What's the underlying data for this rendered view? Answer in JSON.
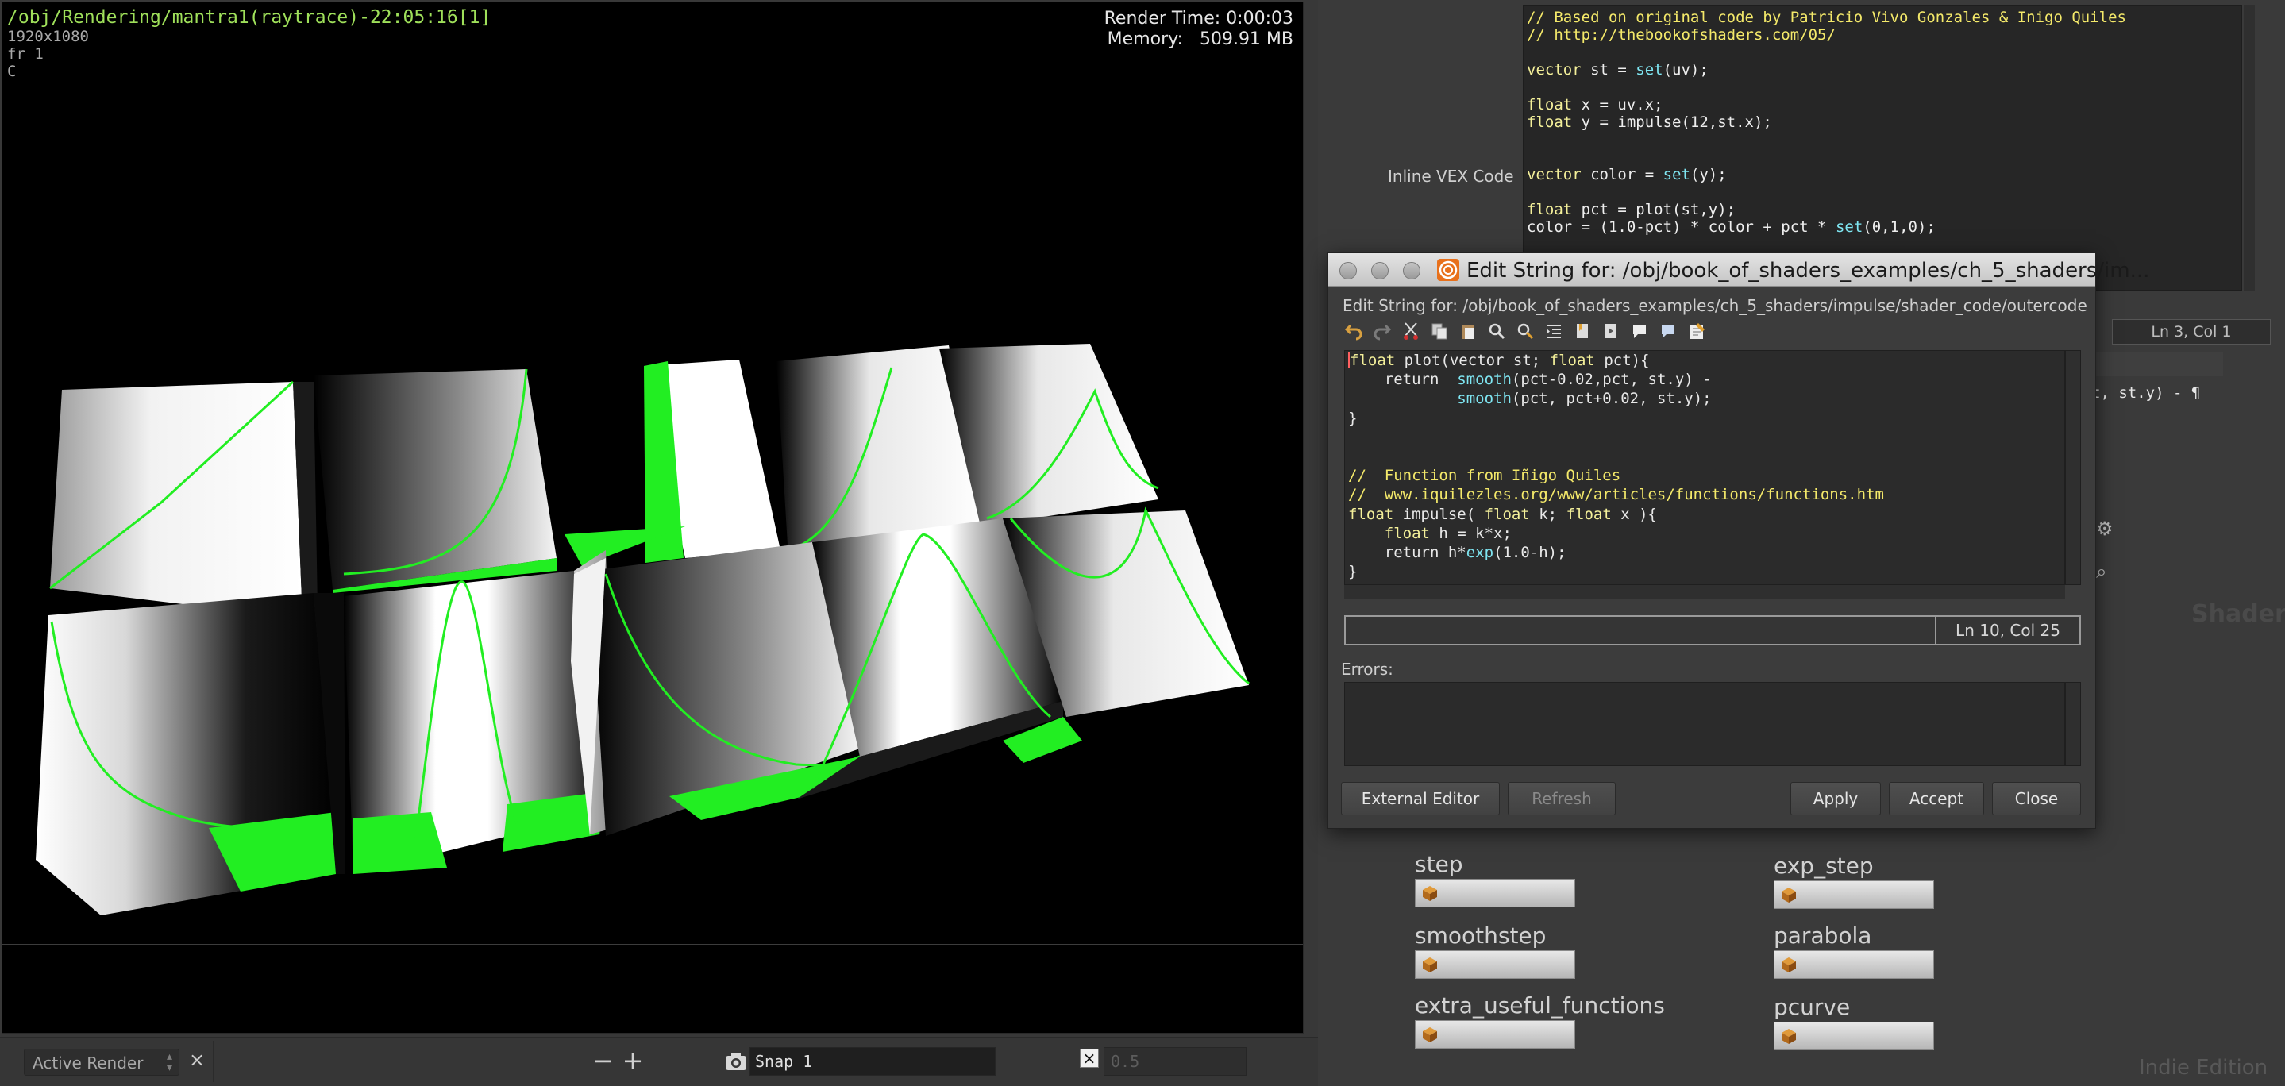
{
  "render_view": {
    "path": "/obj/Rendering/mantra1(raytrace)-22:05:16[1]",
    "resolution": "1920x1080",
    "frame": "fr 1",
    "channel": "C",
    "render_time_label": "Render Time:",
    "render_time": "0:00:03",
    "memory_label": "Memory:",
    "memory": "509.91 MB"
  },
  "render_toolbar": {
    "active_render": "Active Render",
    "close_glyph": "×",
    "minus": "−",
    "plus": "+",
    "snap_value": "Snap 1",
    "toggle_glyph": "×",
    "gamma_value": "0.5"
  },
  "background_params": {
    "inline_vex_label": "Inline VEX Code",
    "code_lines": [
      [
        {
          "t": "// Based on original code by Patricio Vivo Gonzales & Inigo Quiles",
          "c": "cm"
        }
      ],
      [
        {
          "t": "// http://thebookofshaders.com/05/",
          "c": "cm"
        }
      ],
      [],
      [
        {
          "t": "vector",
          "c": "kw"
        },
        {
          "t": " st = "
        },
        {
          "t": "set",
          "c": "fn"
        },
        {
          "t": "(uv);"
        }
      ],
      [],
      [
        {
          "t": "float",
          "c": "kw"
        },
        {
          "t": " x = uv.x;"
        }
      ],
      [
        {
          "t": "float",
          "c": "kw"
        },
        {
          "t": " y = impulse(12,st.x);"
        }
      ],
      [],
      [],
      [
        {
          "t": "vector",
          "c": "kw"
        },
        {
          "t": " color = "
        },
        {
          "t": "set",
          "c": "fn"
        },
        {
          "t": "(y);"
        }
      ],
      [],
      [
        {
          "t": "float",
          "c": "kw"
        },
        {
          "t": " pct = plot(st,y);"
        }
      ],
      [
        {
          "t": "color = (1.0-pct) * color + pct * "
        },
        {
          "t": "set",
          "c": "fn"
        },
        {
          "t": "(0,1,0);"
        }
      ]
    ],
    "cursor_pos": "Ln 3, Col 1",
    "partial_code": "t, st.y) - ¶",
    "shaders_label": "Shaders",
    "edition_label": "Indie Edition"
  },
  "nodes": [
    {
      "label": "step"
    },
    {
      "label": "exp_step"
    },
    {
      "label": "smoothstep"
    },
    {
      "label": "parabola"
    },
    {
      "label": "extra_useful_functions"
    },
    {
      "label": "pcurve"
    }
  ],
  "dialog": {
    "title": "Edit String for: /obj/book_of_shaders_examples/ch_5_shaders/im...",
    "subtitle": "Edit String for: /obj/book_of_shaders_examples/ch_5_shaders/impulse/shader_code/outercode",
    "toolbar_icons": [
      "undo-icon",
      "redo-icon",
      "cut-icon",
      "copy-icon",
      "paste-icon",
      "find-icon",
      "replace-icon",
      "indent-icon",
      "bookmark-icon",
      "bookmark-next-icon",
      "comment-icon",
      "uncomment-icon",
      "notes-icon"
    ],
    "code_lines": [
      [
        {
          "t": "float",
          "c": "kw"
        },
        {
          "t": " plot(vector st; "
        },
        {
          "t": "float",
          "c": "kw"
        },
        {
          "t": " pct){"
        }
      ],
      [
        {
          "t": "    return  "
        },
        {
          "t": "smooth",
          "c": "fn"
        },
        {
          "t": "(pct-0.02,pct, st.y) -"
        }
      ],
      [
        {
          "t": "            "
        },
        {
          "t": "smooth",
          "c": "fn"
        },
        {
          "t": "(pct, pct+0.02, st.y);"
        }
      ],
      [
        {
          "t": "}"
        }
      ],
      [],
      [],
      [
        {
          "t": "//  Function from Iñigo Quiles",
          "c": "cm"
        }
      ],
      [
        {
          "t": "//  www.iquilezles.org/www/articles/functions/functions.htm",
          "c": "cm"
        }
      ],
      [
        {
          "t": "float",
          "c": "kw"
        },
        {
          "t": " impulse( "
        },
        {
          "t": "float",
          "c": "kw"
        },
        {
          "t": " k; "
        },
        {
          "t": "float",
          "c": "kw"
        },
        {
          "t": " x ){"
        }
      ],
      [
        {
          "t": "    "
        },
        {
          "t": "float",
          "c": "kw"
        },
        {
          "t": " h = k*x;"
        }
      ],
      [
        {
          "t": "    return h*"
        },
        {
          "t": "exp",
          "c": "fn"
        },
        {
          "t": "(1.0-h);"
        }
      ],
      [
        {
          "t": "}"
        }
      ]
    ],
    "cursor_pos": "Ln 10, Col 25",
    "errors_label": "Errors:",
    "buttons": {
      "external_editor": "External Editor",
      "refresh": "Refresh",
      "apply": "Apply",
      "accept": "Accept",
      "close": "Close"
    }
  },
  "colors": {
    "code_keyword": "#f4f09a",
    "code_function": "#7fe6f2",
    "code_comment": "#f4e96a",
    "render_path": "#9fe05a",
    "curve_green": "#22ee22"
  }
}
